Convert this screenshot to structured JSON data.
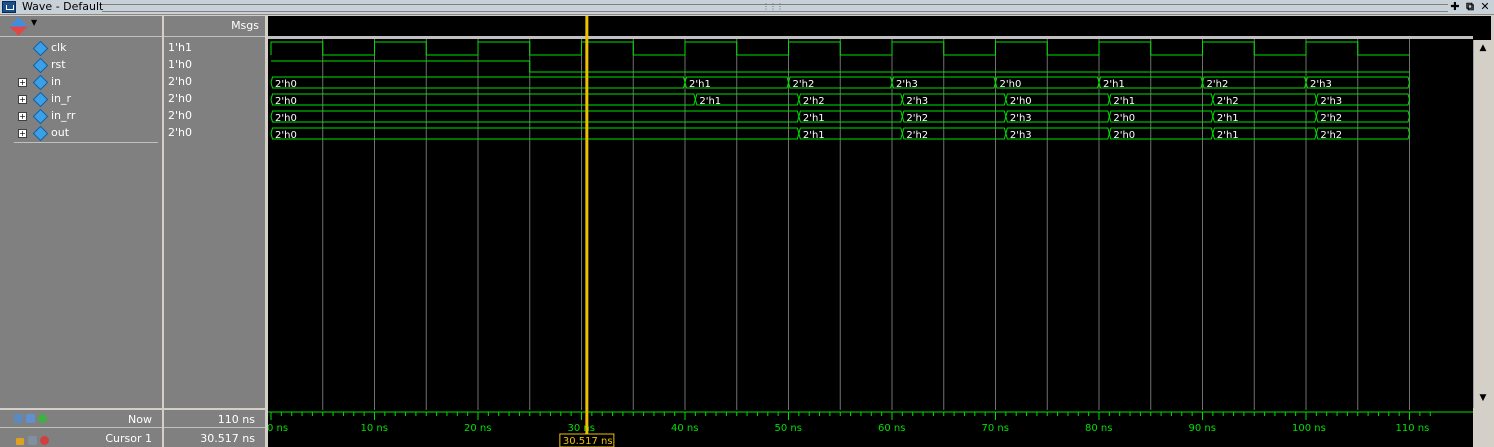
{
  "window": {
    "title": "Wave - Default"
  },
  "header": {
    "msgs_label": "Msgs"
  },
  "signals": [
    {
      "name": "clk",
      "value": "1'h1",
      "expandable": false
    },
    {
      "name": "rst",
      "value": "1'h0",
      "expandable": false
    },
    {
      "name": "in",
      "value": "2'h0",
      "expandable": true
    },
    {
      "name": "in_r",
      "value": "2'h0",
      "expandable": true
    },
    {
      "name": "in_rr",
      "value": "2'h0",
      "expandable": true
    },
    {
      "name": "out",
      "value": "2'h0",
      "expandable": true
    }
  ],
  "timeline": {
    "tick_labels": [
      "0 ns",
      "10 ns",
      "20 ns",
      "30 ns",
      "40 ns",
      "50 ns",
      "60 ns",
      "70 ns",
      "80 ns",
      "90 ns",
      "100 ns",
      "110 ns"
    ],
    "sim_end_ns": 110
  },
  "status": {
    "now_label": "Now",
    "now_value": "110 ns",
    "cursor_label": "Cursor 1",
    "cursor_value": "30.517 ns",
    "cursor_flag": "30.517 ns"
  },
  "waves": {
    "clk_period_ns": 10,
    "rst_high_until_ns": 25,
    "buses": [
      {
        "name": "in",
        "segments": [
          [
            0,
            40,
            "2'h0"
          ],
          [
            40,
            50,
            "2'h1"
          ],
          [
            50,
            60,
            "2'h2"
          ],
          [
            60,
            70,
            "2'h3"
          ],
          [
            70,
            80,
            "2'h0"
          ],
          [
            80,
            90,
            "2'h1"
          ],
          [
            90,
            100,
            "2'h2"
          ],
          [
            100,
            110,
            "2'h3"
          ]
        ]
      },
      {
        "name": "in_r",
        "segments": [
          [
            0,
            41,
            "2'h0"
          ],
          [
            41,
            51,
            "2'h1"
          ],
          [
            51,
            61,
            "2'h2"
          ],
          [
            61,
            71,
            "2'h3"
          ],
          [
            71,
            81,
            "2'h0"
          ],
          [
            81,
            91,
            "2'h1"
          ],
          [
            91,
            101,
            "2'h2"
          ],
          [
            101,
            110,
            "2'h3"
          ]
        ]
      },
      {
        "name": "in_rr",
        "segments": [
          [
            0,
            51,
            "2'h0"
          ],
          [
            51,
            61,
            "2'h1"
          ],
          [
            61,
            71,
            "2'h2"
          ],
          [
            71,
            81,
            "2'h3"
          ],
          [
            81,
            91,
            "2'h0"
          ],
          [
            91,
            101,
            "2'h1"
          ],
          [
            101,
            110,
            "2'h2"
          ]
        ]
      },
      {
        "name": "out",
        "segments": [
          [
            0,
            51,
            "2'h0"
          ],
          [
            51,
            61,
            "2'h1"
          ],
          [
            61,
            71,
            "2'h2"
          ],
          [
            71,
            81,
            "2'h3"
          ],
          [
            81,
            91,
            "2'h0"
          ],
          [
            91,
            101,
            "2'h1"
          ],
          [
            101,
            110,
            "2'h2"
          ]
        ]
      }
    ],
    "cursor_ns": 30.517
  },
  "colors": {
    "wave": "#00e000",
    "cursor": "#f0c000",
    "grid": "#707070",
    "background": "#000000"
  },
  "icons": {
    "window": "wave-window-icon",
    "header": "wave-diamond-icon",
    "signal": "signal-diamond-icon"
  }
}
